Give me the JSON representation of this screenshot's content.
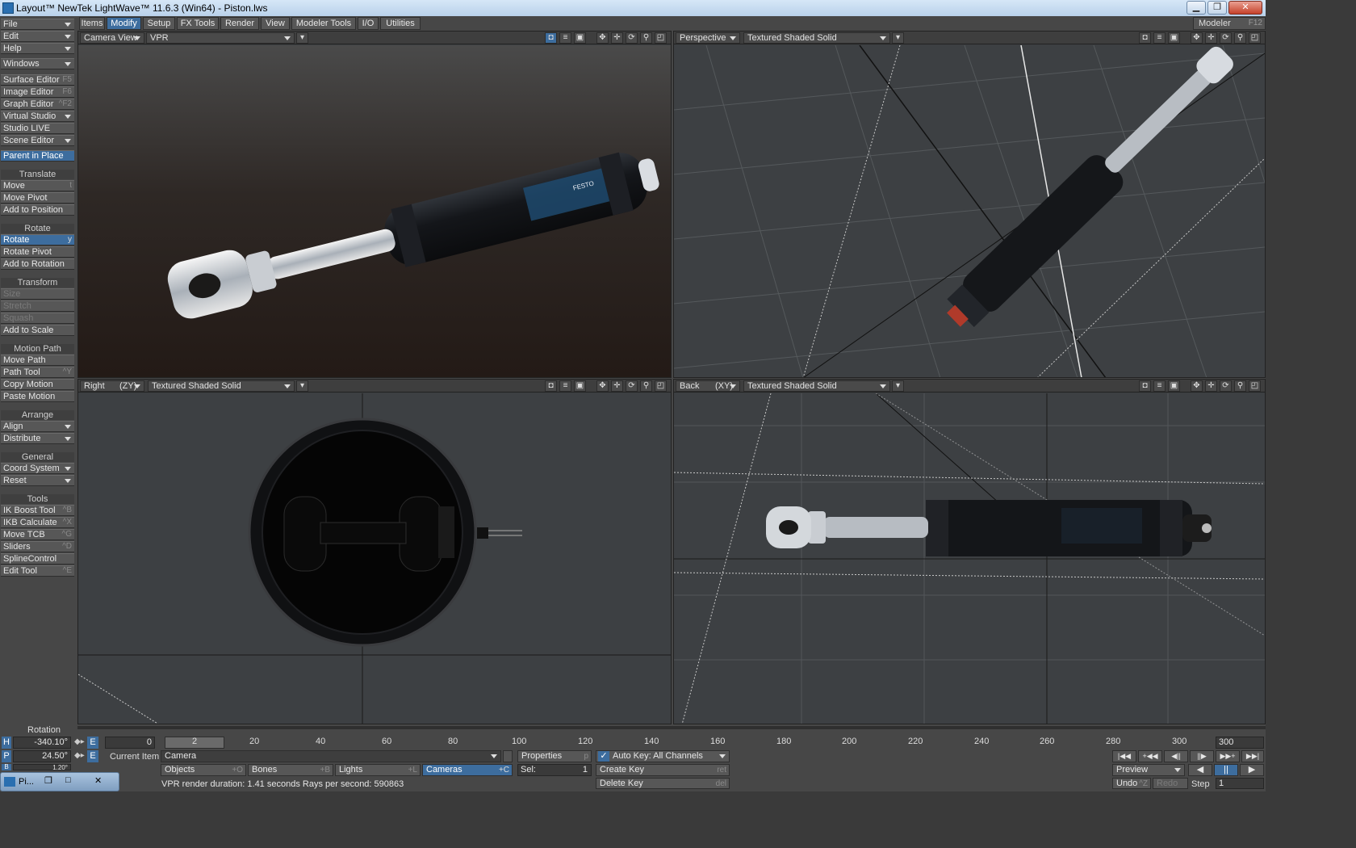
{
  "window": {
    "title": "Layout™ NewTek LightWave™ 11.6.3 (Win64) - Piston.lws",
    "minimize_glyph": "▁",
    "restore_glyph": "❐",
    "close_glyph": "✕"
  },
  "menu_tabs": [
    "Items",
    "Modify",
    "Setup",
    "FX Tools",
    "Render",
    "View",
    "Modeler Tools",
    "I/O",
    "Utilities"
  ],
  "active_tab": "Modify",
  "modeler": {
    "label": "Modeler",
    "shortcut": "F12"
  },
  "left_panel": {
    "file": "File",
    "edit": "Edit",
    "help": "Help",
    "windows": "Windows",
    "editors": [
      {
        "label": "Surface Editor",
        "shortcut": "F5"
      },
      {
        "label": "Image Editor",
        "shortcut": "F6"
      },
      {
        "label": "Graph Editor",
        "shortcut": "^F2"
      },
      {
        "label": "Virtual Studio",
        "shortcut": ""
      },
      {
        "label": "Studio LIVE",
        "shortcut": ""
      },
      {
        "label": "Scene Editor",
        "shortcut": ""
      }
    ],
    "parent_in_place": "Parent in Place",
    "translate_header": "Translate",
    "translate": [
      {
        "label": "Move",
        "shortcut": "t"
      },
      {
        "label": "Move Pivot",
        "shortcut": ""
      },
      {
        "label": "Add to Position",
        "shortcut": ""
      }
    ],
    "rotate_header": "Rotate",
    "rotate": [
      {
        "label": "Rotate",
        "shortcut": "y"
      },
      {
        "label": "Rotate Pivot",
        "shortcut": ""
      },
      {
        "label": "Add to Rotation",
        "shortcut": ""
      }
    ],
    "transform_header": "Transform",
    "transform": [
      {
        "label": "Size",
        "shortcut": ""
      },
      {
        "label": "Stretch",
        "shortcut": ""
      },
      {
        "label": "Squash",
        "shortcut": ""
      },
      {
        "label": "Add to Scale",
        "shortcut": ""
      }
    ],
    "motion_header": "Motion Path",
    "motion": [
      {
        "label": "Move Path",
        "shortcut": ""
      },
      {
        "label": "Path Tool",
        "shortcut": "^Y"
      },
      {
        "label": "Copy Motion",
        "shortcut": ""
      },
      {
        "label": "Paste Motion",
        "shortcut": ""
      }
    ],
    "arrange_header": "Arrange",
    "arrange": [
      {
        "label": "Align"
      },
      {
        "label": "Distribute"
      }
    ],
    "general_header": "General",
    "general": [
      {
        "label": "Coord System"
      },
      {
        "label": "Reset"
      }
    ],
    "tools_header": "Tools",
    "tools": [
      {
        "label": "IK Boost Tool",
        "shortcut": "^B"
      },
      {
        "label": "IKB Calculate",
        "shortcut": "^X"
      },
      {
        "label": "Move TCB",
        "shortcut": "^G"
      },
      {
        "label": "Sliders",
        "shortcut": "^D"
      },
      {
        "label": "SplineControl",
        "shortcut": ""
      },
      {
        "label": "Edit Tool",
        "shortcut": "^E"
      }
    ]
  },
  "viewports": {
    "top_left": {
      "view": "Camera View",
      "mode": "VPR"
    },
    "top_right": {
      "view": "Perspective",
      "mode": "Textured Shaded Solid"
    },
    "bottom_left": {
      "view": "Right",
      "axis": "(ZY)",
      "mode": "Textured Shaded Solid"
    },
    "bottom_right": {
      "view": "Back",
      "axis": "(XY)",
      "mode": "Textured Shaded Solid"
    }
  },
  "decal": {
    "brand": "FESTO"
  },
  "timeline": {
    "current_frame": "0",
    "frame_marker": "2",
    "ticks": [
      "20",
      "40",
      "60",
      "80",
      "100",
      "120",
      "140",
      "160",
      "180",
      "200",
      "220",
      "240",
      "260",
      "280",
      "300"
    ],
    "end_frame": "300"
  },
  "rotation": {
    "header": "Rotation",
    "h": {
      "label": "H",
      "value": "-340.10°"
    },
    "p": {
      "label": "P",
      "value": "24.50°"
    },
    "b": {
      "label": "B",
      "value": "1.20°"
    },
    "e_label": "E"
  },
  "current_item": {
    "label": "Current Item",
    "value": "Camera"
  },
  "properties": {
    "label": "Properties",
    "shortcut": "p"
  },
  "item_filters": [
    {
      "label": "Objects",
      "shortcut": "+O"
    },
    {
      "label": "Bones",
      "shortcut": "+B"
    },
    {
      "label": "Lights",
      "shortcut": "+L"
    },
    {
      "label": "Cameras",
      "shortcut": "+C"
    }
  ],
  "sel": {
    "label": "Sel:",
    "value": "1"
  },
  "status": "VPR render duration: 1.41 seconds  Rays per second: 590863",
  "autokey": {
    "label": "Auto Key: All Channels"
  },
  "create_key": {
    "label": "Create Key",
    "shortcut": "ret"
  },
  "delete_key": {
    "label": "Delete Key",
    "shortcut": "del"
  },
  "preview": {
    "label": "Preview"
  },
  "undo": {
    "label": "Undo",
    "shortcut": "^Z"
  },
  "redo": {
    "label": "Redo"
  },
  "step": {
    "label": "Step",
    "value": "1"
  },
  "transport": [
    "|◀◀",
    "+◀◀",
    "◀||",
    "||▶",
    "▶▶+",
    "▶▶|"
  ],
  "play": {
    "back": "◀",
    "pause": "||",
    "forward": "▶"
  },
  "taskbar": {
    "label": "Pi...",
    "restore": "❐",
    "max": "□",
    "close": "✕"
  }
}
